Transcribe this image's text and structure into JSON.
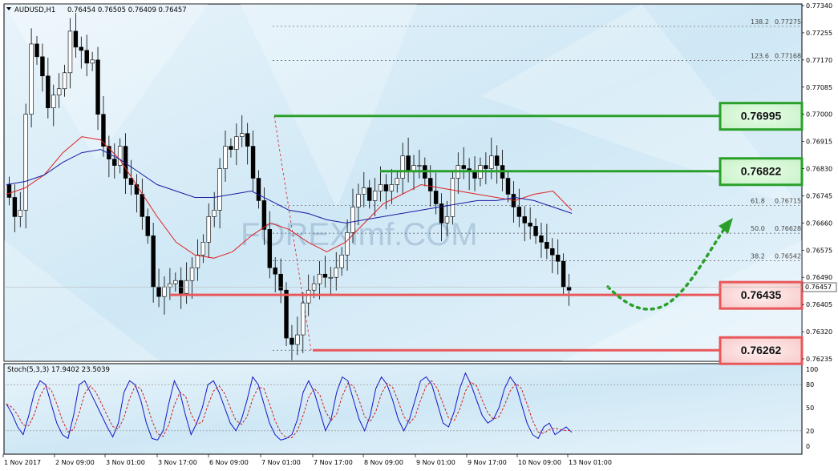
{
  "header": {
    "symbol": "AUDUSD,H1",
    "ohlc": "0.76454 0.76505 0.76409 0.76457"
  },
  "stoch_header": "Stoch(5,3,3) 17.9402 23.5039",
  "watermark": "FOREXimf.COM",
  "current_price": "0.76457",
  "colors": {
    "support": "#e8585a",
    "resistance": "#2aa02a",
    "ma_fast": "#e02020",
    "ma_slow": "#1a1aa0",
    "stoch_main": "#1515c8",
    "stoch_signal": "#d02020",
    "projection": "#2aa02a"
  },
  "chart_data": {
    "type": "candlestick",
    "title": "AUDUSD,H1",
    "ylim": [
      0.762,
      0.7735
    ],
    "y_ticks": [
      "0.77340",
      "0.77255",
      "0.77170",
      "0.77085",
      "0.77000",
      "0.76915",
      "0.76830",
      "0.76745",
      "0.76660",
      "0.76575",
      "0.76490",
      "0.76405",
      "0.76320",
      "0.76235"
    ],
    "x_ticks": [
      "1 Nov 2017",
      "2 Nov 09:00",
      "3 Nov 01:00",
      "3 Nov 17:00",
      "6 Nov 09:00",
      "7 Nov 01:00",
      "7 Nov 17:00",
      "8 Nov 09:00",
      "9 Nov 01:00",
      "9 Nov 17:00",
      "10 Nov 09:00",
      "13 Nov 01:00"
    ],
    "close_path": [
      0.7674,
      0.7668,
      0.767,
      0.77,
      0.7722,
      0.7718,
      0.7712,
      0.7702,
      0.7706,
      0.7708,
      0.7713,
      0.7726,
      0.7721,
      0.772,
      0.7716,
      0.7717,
      0.77,
      0.769,
      0.7686,
      0.7684,
      0.769,
      0.768,
      0.7678,
      0.7675,
      0.7668,
      0.7662,
      0.7646,
      0.7643,
      0.7646,
      0.7647,
      0.7648,
      0.7644,
      0.7648,
      0.7652,
      0.7656,
      0.766,
      0.7668,
      0.767,
      0.7683,
      0.769,
      0.7689,
      0.7693,
      0.7694,
      0.769,
      0.768,
      0.7673,
      0.7664,
      0.7652,
      0.765,
      0.7645,
      0.763,
      0.7628,
      0.7631,
      0.7641,
      0.7645,
      0.7647,
      0.765,
      0.7649,
      0.7649,
      0.7652,
      0.7656,
      0.7663,
      0.7671,
      0.7675,
      0.7677,
      0.7673,
      0.7676,
      0.7678,
      0.7676,
      0.7678,
      0.768,
      0.7687,
      0.7682,
      0.7684,
      0.7684,
      0.768,
      0.7676,
      0.7672,
      0.7666,
      0.7668,
      0.768,
      0.7684,
      0.7683,
      0.7682,
      0.768,
      0.7684,
      0.7683,
      0.7687,
      0.7684,
      0.768,
      0.7675,
      0.7671,
      0.7668,
      0.7666,
      0.7665,
      0.7662,
      0.766,
      0.7658,
      0.7656,
      0.7654,
      0.7646,
      0.7645
    ],
    "moving_averages": [
      {
        "period": "fast",
        "color": "red",
        "values": [
          0.7675,
          0.7677,
          0.7681,
          0.7688,
          0.7693,
          0.7692,
          0.7686,
          0.7677,
          0.7668,
          0.766,
          0.7656,
          0.7655,
          0.7657,
          0.7662,
          0.7666,
          0.7664,
          0.766,
          0.7657,
          0.766,
          0.7666,
          0.7672,
          0.7675,
          0.7678,
          0.7677,
          0.7676,
          0.7675,
          0.7674,
          0.7673,
          0.7675,
          0.7676,
          0.767
        ]
      },
      {
        "period": "slow",
        "color": "blue",
        "values": [
          0.7678,
          0.7679,
          0.7681,
          0.7685,
          0.7688,
          0.7689,
          0.7686,
          0.7682,
          0.7678,
          0.7676,
          0.7674,
          0.7674,
          0.7675,
          0.7676,
          0.7673,
          0.767,
          0.7669,
          0.7667,
          0.7666,
          0.7667,
          0.7668,
          0.7669,
          0.767,
          0.7671,
          0.7672,
          0.7673,
          0.7673,
          0.7674,
          0.7673,
          0.7671,
          0.7669
        ]
      }
    ],
    "horizontal_levels": [
      {
        "label": "0.76995",
        "value": 0.76995,
        "kind": "resistance"
      },
      {
        "label": "0.76822",
        "value": 0.76822,
        "kind": "resistance"
      },
      {
        "label": "0.76435",
        "value": 0.76435,
        "kind": "support"
      },
      {
        "label": "0.76262",
        "value": 0.76262,
        "kind": "support"
      }
    ],
    "fibonacci": [
      {
        "label": "138.2",
        "value": "0.77275"
      },
      {
        "label": "123.6",
        "value": "0.77168"
      },
      {
        "label": "61.8",
        "value": "0.76715"
      },
      {
        "label": "50.0",
        "value": "0.76628"
      },
      {
        "label": "38.2",
        "value": "0.76542"
      }
    ],
    "stochastic": {
      "name": "Stoch(5,3,3)",
      "main": 17.9402,
      "signal": 23.5039,
      "levels": [
        "100",
        "80",
        "50",
        "20",
        "0"
      ],
      "main_path": [
        55,
        42,
        25,
        15,
        40,
        70,
        85,
        80,
        55,
        30,
        15,
        10,
        40,
        80,
        85,
        70,
        55,
        40,
        25,
        12,
        30,
        70,
        85,
        80,
        60,
        30,
        10,
        8,
        20,
        55,
        85,
        70,
        40,
        15,
        30,
        50,
        80,
        85,
        70,
        50,
        30,
        20,
        35,
        60,
        90,
        80,
        55,
        30,
        15,
        8,
        10,
        15,
        35,
        70,
        85,
        70,
        45,
        20,
        35,
        70,
        90,
        85,
        60,
        35,
        20,
        40,
        75,
        90,
        80,
        60,
        35,
        20,
        35,
        60,
        85,
        90,
        80,
        55,
        30,
        25,
        45,
        75,
        95,
        80,
        60,
        40,
        30,
        35,
        50,
        75,
        90,
        80,
        55,
        30,
        15,
        10,
        25,
        30,
        15,
        20,
        25,
        18
      ]
    }
  }
}
